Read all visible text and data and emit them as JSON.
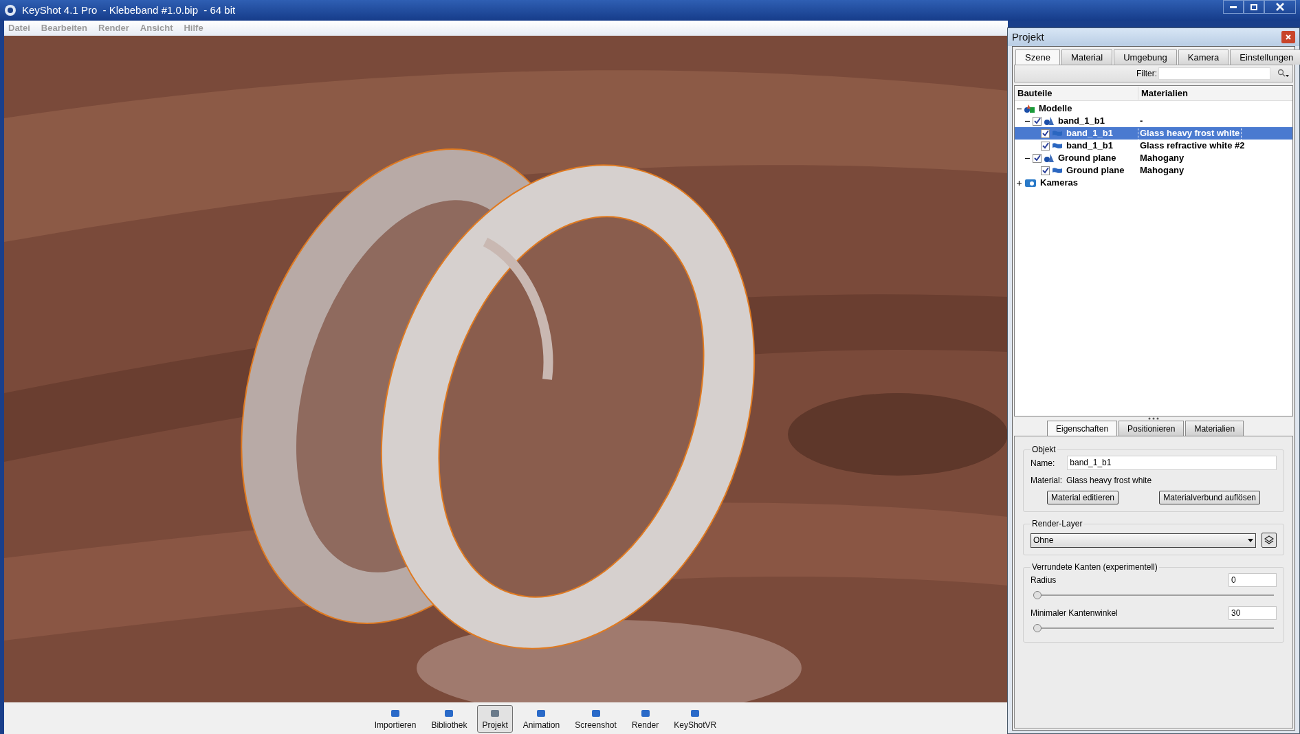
{
  "window": {
    "title": "KeyShot 4.1 Pro  - Klebeband #1.0.bip  - 64 bit"
  },
  "menu": [
    "Datei",
    "Bearbeiten",
    "Render",
    "Ansicht",
    "Hilfe"
  ],
  "toolbar": [
    {
      "label": "Importieren",
      "selected": false
    },
    {
      "label": "Bibliothek",
      "selected": false
    },
    {
      "label": "Projekt",
      "selected": true
    },
    {
      "label": "Animation",
      "selected": false
    },
    {
      "label": "Screenshot",
      "selected": false
    },
    {
      "label": "Render",
      "selected": false
    },
    {
      "label": "KeyShotVR",
      "selected": false
    }
  ],
  "panel": {
    "title": "Projekt",
    "tabs": [
      {
        "label": "Szene",
        "selected": true
      },
      {
        "label": "Material",
        "selected": false
      },
      {
        "label": "Umgebung",
        "selected": false
      },
      {
        "label": "Kamera",
        "selected": false
      },
      {
        "label": "Einstellungen",
        "selected": false
      }
    ],
    "filter": {
      "label": "Filter:"
    },
    "tree": {
      "columns": [
        "Bauteile",
        "Materialien"
      ],
      "items": [
        {
          "kind": "models",
          "label": "Modelle",
          "expanded": true,
          "selected": false,
          "children": [
            {
              "kind": "group",
              "label": "band_1_b1",
              "material": "-",
              "checked": true,
              "expanded": true,
              "selected": false,
              "children": [
                {
                  "kind": "part",
                  "label": "band_1_b1",
                  "material": "Glass heavy frost white",
                  "checked": true,
                  "selected": true
                },
                {
                  "kind": "part",
                  "label": "band_1_b1",
                  "material": "Glass refractive white #2",
                  "checked": true,
                  "selected": false
                }
              ]
            },
            {
              "kind": "group",
              "label": "Ground plane",
              "material": "Mahogany",
              "checked": true,
              "expanded": true,
              "selected": false,
              "children": [
                {
                  "kind": "part",
                  "label": "Ground plane",
                  "material": "Mahogany",
                  "checked": true,
                  "selected": false
                }
              ]
            }
          ]
        },
        {
          "kind": "cameras",
          "label": "Kameras",
          "expanded": false,
          "selected": false
        }
      ]
    },
    "subtabs": [
      {
        "label": "Eigenschaften",
        "selected": true
      },
      {
        "label": "Positionieren",
        "selected": false
      },
      {
        "label": "Materialien",
        "selected": false
      }
    ],
    "object": {
      "title": "Objekt",
      "name_label": "Name:",
      "name_value": "band_1_b1",
      "material_label": "Material:",
      "material_value": "Glass heavy frost white",
      "buttons": [
        "Material editieren",
        "Materialverbund auflösen"
      ]
    },
    "render_layer": {
      "title": "Render-Layer",
      "value": "Ohne"
    },
    "edges": {
      "title": "Verrundete Kanten (experimentell)",
      "sliders": [
        {
          "label": "Radius",
          "value": "0",
          "level": 0
        },
        {
          "label": "Minimaler Kantenwinkel",
          "value": "30",
          "level": 0
        }
      ]
    }
  }
}
